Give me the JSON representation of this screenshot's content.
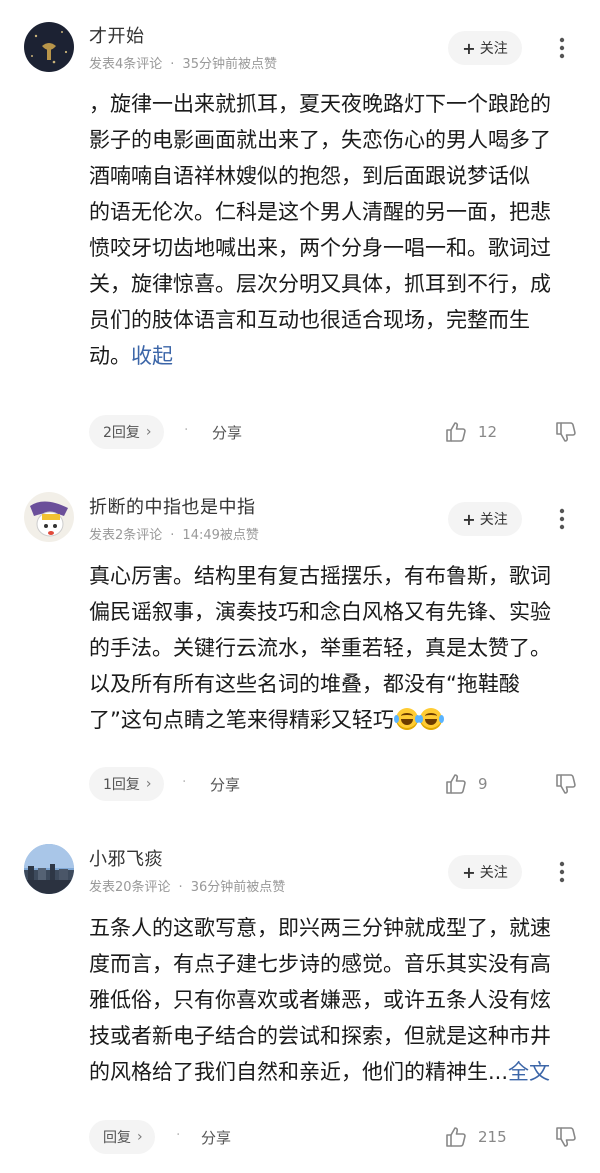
{
  "comments": [
    {
      "username": "才开始",
      "meta_posts": "发表4条评论",
      "meta_time": "35分钟前被点赞",
      "follow_label": "关注",
      "body": "，旋律一出来就抓耳，夏天夜晚路灯下一个踉跄的\n影子的电影画面就出来了，失恋伤心的男人喝多了\n酒喃喃自语祥林嫂似的抱怨，到后面跟说梦话似\n的语无伦次。仁科是这个男人清醒的另一面，把悲\n愤咬牙切齿地喊出来，两个分身一唱一和。歌词过\n关，旋律惊喜。层次分明又具体，抓耳到不行，成\n员们的肢体语言和互动也很适合现场，完整而生\n动。",
      "body_link": "收起",
      "reply_label": "2回复",
      "share_label": "分享",
      "likes": "12"
    },
    {
      "username": "折断的中指也是中指",
      "meta_posts": "发表2条评论",
      "meta_time": "14:49被点赞",
      "follow_label": "关注",
      "body": "真心厉害。结构里有复古摇摆乐，有布鲁斯，歌词\n偏民谣叙事，演奏技巧和念白风格又有先锋、实验\n的手法。关键行云流水，举重若轻，真是太赞了。\n以及所有所有这些名词的堆叠，都没有“拖鞋酸\n了”这句点睛之笔来得精彩又轻巧",
      "reply_label": "1回复",
      "share_label": "分享",
      "likes": "9"
    },
    {
      "username": "小邪飞痰",
      "meta_posts": "发表20条评论",
      "meta_time": "36分钟前被点赞",
      "follow_label": "关注",
      "body": "五条人的这歌写意，即兴两三分钟就成型了，就速\n度而言，有点子建七步诗的感觉。音乐其实没有高\n雅低俗，只有你喜欢或者嫌恶，或许五条人没有炫\n技或者新电子结合的尝试和探索，但就是这种市井\n的风格给了我们自然和亲近，他们的精神生...",
      "body_link": "全文",
      "reply_label": "回复",
      "share_label": "分享",
      "likes": "215"
    }
  ],
  "icons": {
    "more": "more-vertical-icon",
    "like": "thumbs-up-icon",
    "dislike": "thumbs-down-icon",
    "reply_chevron": "chevron-right-icon",
    "emoji": "laughing-tears-emoji"
  },
  "colors": {
    "link": "#3c66a8",
    "meta": "#999999",
    "button_bg": "#f4f4f4"
  }
}
